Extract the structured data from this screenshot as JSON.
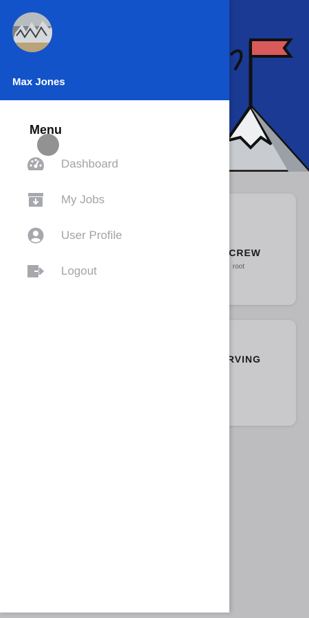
{
  "drawer": {
    "user_name": "Max Jones",
    "menu_title": "Menu",
    "items": [
      {
        "label": "Dashboard",
        "icon": "dashboard-gauge-icon"
      },
      {
        "label": "My Jobs",
        "icon": "archive-box-icon"
      },
      {
        "label": "User Profile",
        "icon": "account-circle-icon"
      },
      {
        "label": "Logout",
        "icon": "logout-exit-icon"
      }
    ]
  },
  "background": {
    "cards": [
      {
        "title": "CREW",
        "subtitle": "root"
      },
      {
        "title": "RVING",
        "subtitle": ""
      }
    ]
  },
  "colors": {
    "drawer_header": "#1353c9",
    "hero_bg": "#1a3a94",
    "menu_label": "#a3a3a8",
    "icon_gray": "#a7a8ad",
    "page_dim": "#bdbdc0"
  }
}
